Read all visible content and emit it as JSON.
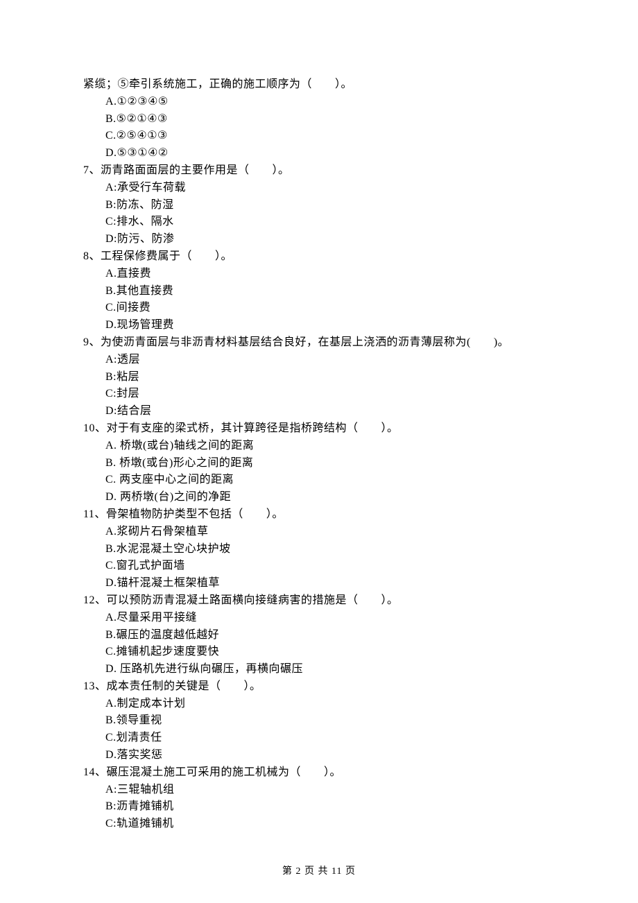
{
  "intro_line": "紧缆；⑤牵引系统施工，正确的施工顺序为（　　）。",
  "q6": {
    "a": "A.①②③④⑤",
    "b": "B.⑤②①④③",
    "c": "C.②⑤④①③",
    "d": "D.⑤③①④②"
  },
  "q7": {
    "stem": "7、沥青路面面层的主要作用是（　　）。",
    "a": "A:承受行车荷载",
    "b": "B:防冻、防湿",
    "c": "C:排水、隔水",
    "d": "D:防污、防渗"
  },
  "q8": {
    "stem": "8、工程保修费属于（　　）。",
    "a": "A.直接费",
    "b": "B.其他直接费",
    "c": "C.间接费",
    "d": "D.现场管理费"
  },
  "q9": {
    "stem": "9、为使沥青面层与非沥青材料基层结合良好，在基层上浇洒的沥青薄层称为(　　)。",
    "a": "A:透层",
    "b": "B:粘层",
    "c": "C:封层",
    "d": "D:结合层"
  },
  "q10": {
    "stem": "10、对于有支座的梁式桥，其计算跨径是指桥跨结构（　　）。",
    "a": "A.  桥墩(或台)轴线之间的距离",
    "b": "B.  桥墩(或台)形心之间的距离",
    "c": "C.  两支座中心之间的距离",
    "d": "D.  两桥墩(台)之间的净距"
  },
  "q11": {
    "stem": "11、骨架植物防护类型不包括（　　）。",
    "a": "A.浆砌片石骨架植草",
    "b": "B.水泥混凝土空心块护坡",
    "c": "C.窗孔式护面墙",
    "d": "D.锚杆混凝土框架植草"
  },
  "q12": {
    "stem": "12、可以预防沥青混凝土路面横向接缝病害的措施是（　　）。",
    "a": "A.尽量采用平接缝",
    "b": "B.碾压的温度越低越好",
    "c": "C.摊铺机起步速度要快",
    "d": "D. 压路机先进行纵向碾压，再横向碾压"
  },
  "q13": {
    "stem": "13、成本责任制的关键是（　　）。",
    "a": "A.制定成本计划",
    "b": "B.领导重视",
    "c": "C.划清责任",
    "d": "D.落实奖惩"
  },
  "q14": {
    "stem": "14、碾压混凝土施工可采用的施工机械为（　　）。",
    "a": "A:三辊轴机组",
    "b": "B:沥青摊铺机",
    "c": "C:轨道摊铺机"
  },
  "footer": "第 2 页 共 11 页"
}
